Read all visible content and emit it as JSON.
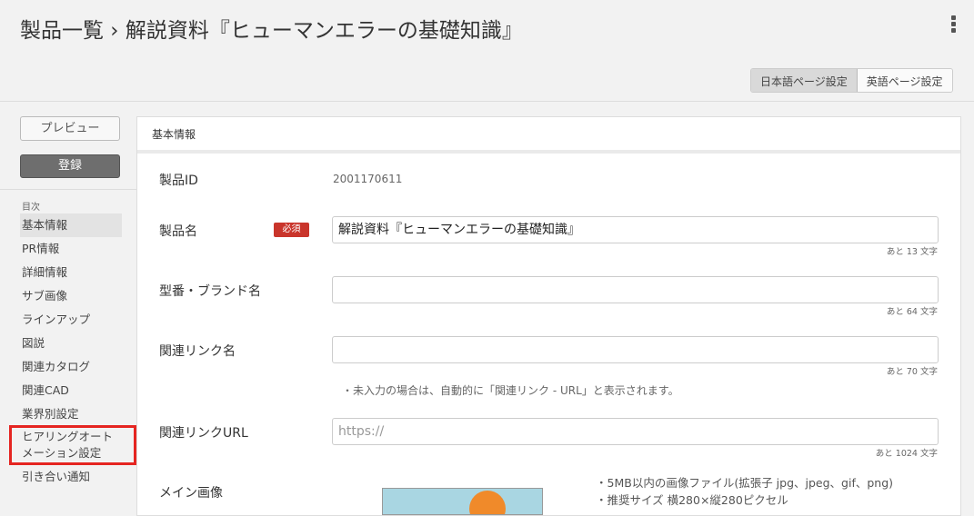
{
  "header": {
    "title": "製品一覧 › 解説資料『ヒューマンエラーの基礎知識』",
    "lang_tabs": [
      "日本語ページ設定",
      "英語ページ設定"
    ]
  },
  "sidebar": {
    "preview": "プレビュー",
    "register": "登録",
    "toc_heading": "目次",
    "items": [
      "基本情報",
      "PR情報",
      "詳細情報",
      "サブ画像",
      "ラインアップ",
      "図説",
      "関連カタログ",
      "関連CAD",
      "業界別設定",
      "ヒアリングオートメーション設定",
      "引き合い通知"
    ]
  },
  "form": {
    "section": "基本情報",
    "product_id_label": "製品ID",
    "product_id": "2001170611",
    "name_label": "製品名",
    "required": "必須",
    "name_value": "解説資料『ヒューマンエラーの基礎知識』",
    "name_count": "あと 13 文字",
    "model_label": "型番・ブランド名",
    "model_count": "あと 64 文字",
    "link_name_label": "関連リンク名",
    "link_name_count": "あと 70 文字",
    "link_name_note": "・未入力の場合は、自動的に「関連リンク - URL」と表示されます。",
    "link_url_label": "関連リンクURL",
    "link_url_placeholder": "https://",
    "link_url_count": "あと 1024 文字",
    "image_label": "メイン画像",
    "image_notes": [
      "・5MB以内の画像ファイル(拡張子 jpg、jpeg、gif、png)",
      "・推奨サイズ 横280×縦280ピクセル"
    ]
  }
}
